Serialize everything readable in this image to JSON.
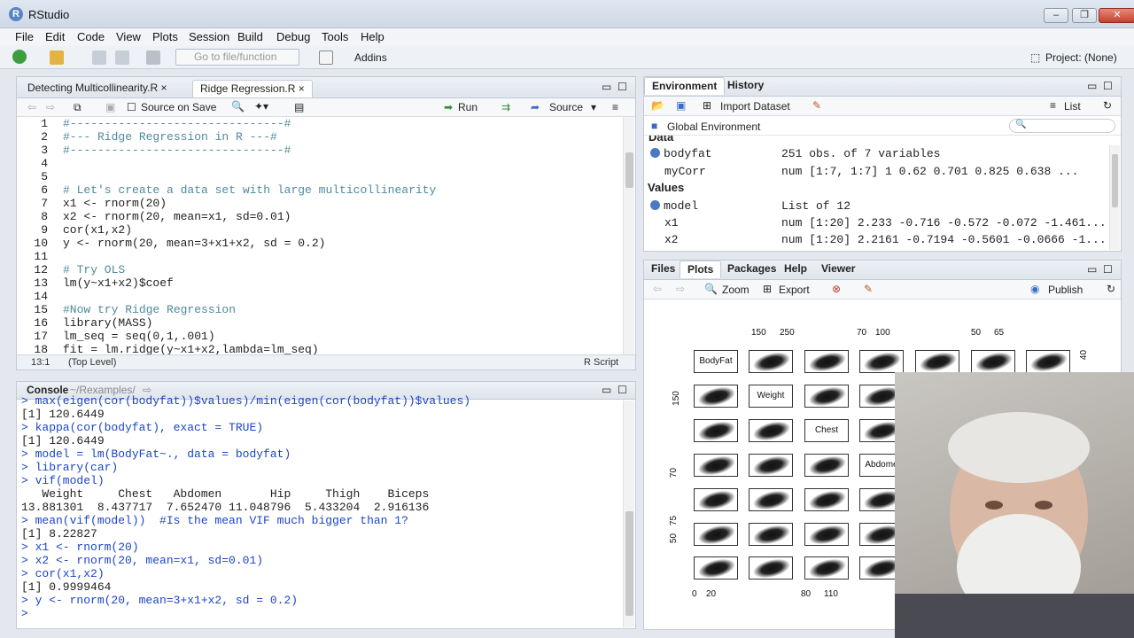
{
  "window": {
    "title": "RStudio",
    "controls": [
      "–",
      "❐",
      "✕"
    ]
  },
  "menu": [
    "File",
    "Edit",
    "Code",
    "View",
    "Plots",
    "Session",
    "Build",
    "Debug",
    "Tools",
    "Help"
  ],
  "toolbar": {
    "goto_placeholder": "Go to file/function",
    "addins": "Addins",
    "project": "Project: (None)"
  },
  "editor": {
    "tabs": [
      {
        "label": "Detecting Multicollinearity.R",
        "active": false
      },
      {
        "label": "Ridge Regression.R",
        "active": true
      }
    ],
    "source_on_save": "Source on Save",
    "run": "Run",
    "source": "Source",
    "lines": [
      {
        "n": "1",
        "text": "#-------------------------------#",
        "kind": "cm"
      },
      {
        "n": "2",
        "text": "#--- Ridge Regression in R ---#",
        "kind": "cm"
      },
      {
        "n": "3",
        "text": "#-------------------------------#",
        "kind": "cm"
      },
      {
        "n": "4",
        "text": "",
        "kind": "code"
      },
      {
        "n": "5",
        "text": "",
        "kind": "code"
      },
      {
        "n": "6",
        "text": "# Let's create a data set with large multicollinearity",
        "kind": "cm"
      },
      {
        "n": "7",
        "text": "x1 <- rnorm(20)",
        "kind": "code"
      },
      {
        "n": "8",
        "text": "x2 <- rnorm(20, mean=x1, sd=0.01)",
        "kind": "code"
      },
      {
        "n": "9",
        "text": "cor(x1,x2)",
        "kind": "code"
      },
      {
        "n": "10",
        "text": "y <- rnorm(20, mean=3+x1+x2, sd = 0.2)",
        "kind": "code"
      },
      {
        "n": "11",
        "text": "",
        "kind": "code"
      },
      {
        "n": "12",
        "text": "# Try OLS",
        "kind": "cm"
      },
      {
        "n": "13",
        "text": "lm(y~x1+x2)$coef",
        "kind": "code"
      },
      {
        "n": "14",
        "text": "",
        "kind": "code"
      },
      {
        "n": "15",
        "text": "#Now try Ridge Regression",
        "kind": "cm"
      },
      {
        "n": "16",
        "text": "library(MASS)",
        "kind": "code"
      },
      {
        "n": "17",
        "text": "lm_seq = seq(0,1,.001)",
        "kind": "code"
      },
      {
        "n": "18",
        "text": "fit = lm.ridge(y~x1+x2,lambda=lm_seq)",
        "kind": "code"
      }
    ],
    "cursor_pos": "13:1",
    "scope": "(Top Level)",
    "filetype": "R Script"
  },
  "console": {
    "title": "Console",
    "path": "~/Rexamples/",
    "lines": [
      {
        "text": "> max(eigen(cor(bodyfat))$values)/min(eigen(cor(bodyfat))$values)",
        "kind": "in"
      },
      {
        "text": "[1] 120.6449",
        "kind": "out"
      },
      {
        "text": "> kappa(cor(bodyfat), exact = TRUE)",
        "kind": "in"
      },
      {
        "text": "[1] 120.6449",
        "kind": "out"
      },
      {
        "text": "> model = lm(BodyFat~., data = bodyfat)",
        "kind": "in"
      },
      {
        "text": "> library(car)",
        "kind": "in"
      },
      {
        "text": "> vif(model)",
        "kind": "in"
      },
      {
        "text": "   Weight     Chest   Abdomen       Hip     Thigh    Biceps",
        "kind": "out"
      },
      {
        "text": "13.881301  8.437717  7.652470 11.048796  5.433204  2.916136",
        "kind": "out"
      },
      {
        "text": "> mean(vif(model))  #Is the mean VIF much bigger than 1?",
        "kind": "in"
      },
      {
        "text": "[1] 8.22827",
        "kind": "out"
      },
      {
        "text": "> x1 <- rnorm(20)",
        "kind": "in"
      },
      {
        "text": "> x2 <- rnorm(20, mean=x1, sd=0.01)",
        "kind": "in"
      },
      {
        "text": "> cor(x1,x2)",
        "kind": "in"
      },
      {
        "text": "[1] 0.9999464",
        "kind": "out"
      },
      {
        "text": "> y <- rnorm(20, mean=3+x1+x2, sd = 0.2)",
        "kind": "in"
      },
      {
        "text": "> ",
        "kind": "in"
      }
    ]
  },
  "environment": {
    "tabs": [
      "Environment",
      "History"
    ],
    "import_dataset": "Import Dataset",
    "list_view": "List",
    "scope": "Global Environment",
    "section_data": "Data",
    "section_values": "Values",
    "rows_data": [
      {
        "name": "bodyfat",
        "value": "251 obs. of 7 variables",
        "has_icon": true
      },
      {
        "name": "myCorr",
        "value": "num [1:7, 1:7] 1 0.62 0.701 0.825 0.638 ...",
        "has_icon": false
      }
    ],
    "rows_values": [
      {
        "name": "model",
        "value": "List of 12",
        "has_icon": true
      },
      {
        "name": "x1",
        "value": "num [1:20] 2.233 -0.716 -0.572 -0.072 -1.461...",
        "has_icon": false
      },
      {
        "name": "x2",
        "value": "num [1:20] 2.2161 -0.7194 -0.5601 -0.0666 -1...",
        "has_icon": false
      }
    ]
  },
  "plots": {
    "tabs": [
      "Files",
      "Plots",
      "Packages",
      "Help",
      "Viewer"
    ],
    "zoom": "Zoom",
    "export": "Export",
    "publish": "Publish",
    "diag_labels": [
      "BodyFat",
      "Weight",
      "Chest",
      "Abdome"
    ],
    "top_ticks": [
      "150",
      "250",
      "70",
      "100",
      "50",
      "65"
    ],
    "left_ticks": [
      "150",
      "70",
      "50",
      "75"
    ],
    "bottom_ticks": [
      "0",
      "20",
      "80",
      "110"
    ],
    "right_ticks": [
      "40"
    ]
  }
}
